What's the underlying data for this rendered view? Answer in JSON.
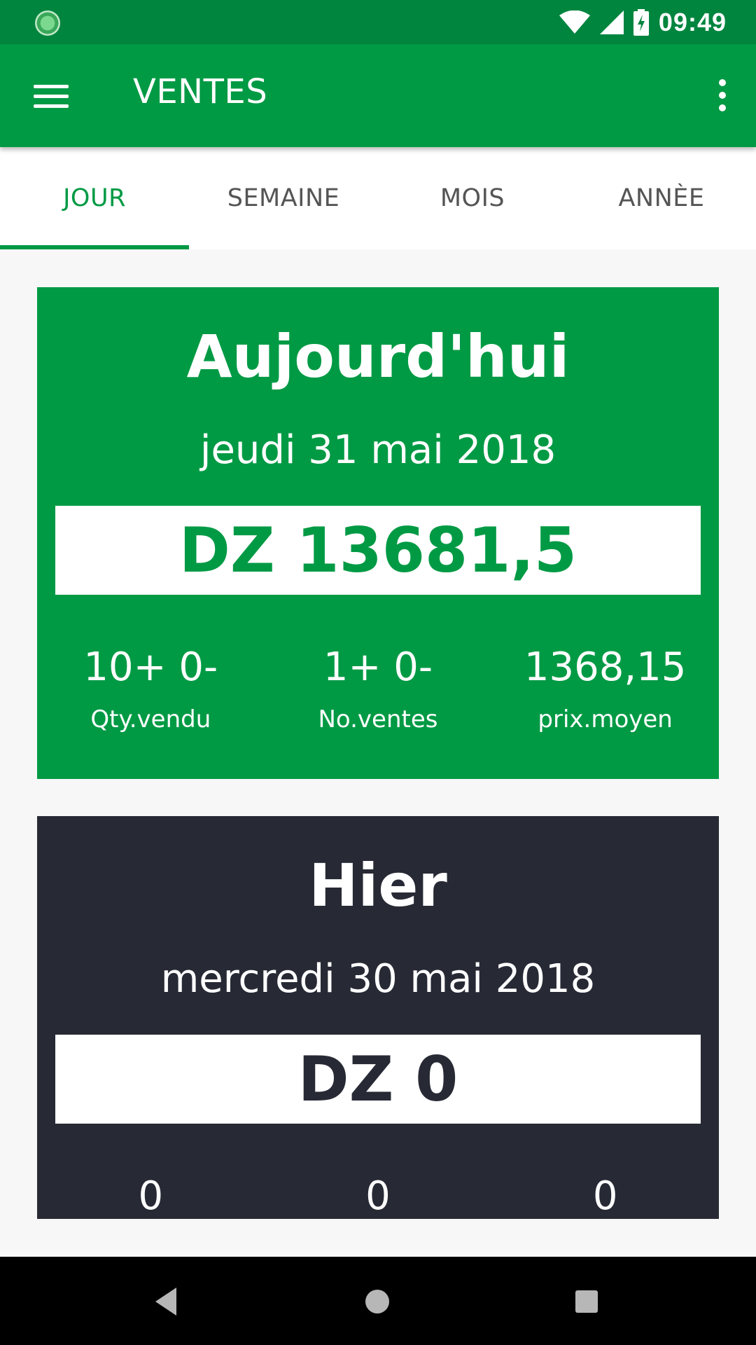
{
  "status_bar": {
    "time": "09:49",
    "icons": [
      "app-status-icon",
      "wifi-icon",
      "signal-icon",
      "battery-charging-icon"
    ]
  },
  "app_bar": {
    "title": "VENTES",
    "menu_icon": "hamburger-menu-icon",
    "overflow_icon": "more-vertical-icon"
  },
  "tabs": [
    {
      "label": "JOUR",
      "active": true
    },
    {
      "label": "SEMAINE",
      "active": false
    },
    {
      "label": "MOIS",
      "active": false
    },
    {
      "label": "ANNÈE",
      "active": false
    }
  ],
  "today": {
    "heading": "Aujourd'hui",
    "date": "jeudi 31 mai 2018",
    "amount": "DZ 13681,5",
    "stats": [
      {
        "value": "10+ 0-",
        "label": "Qty.vendu"
      },
      {
        "value": "1+ 0-",
        "label": "No.ventes"
      },
      {
        "value": "1368,15",
        "label": "prix.moyen"
      }
    ]
  },
  "yesterday": {
    "heading": "Hier",
    "date": "mercredi 30 mai 2018",
    "amount": "DZ 0",
    "stats": [
      {
        "value": "0"
      },
      {
        "value": "0"
      },
      {
        "value": "0"
      }
    ]
  },
  "colors": {
    "status_bar": "#00853f",
    "primary": "#009a44",
    "dark_card": "#272a35",
    "background": "#f7f7f7"
  },
  "nav_bar": {
    "icons": [
      "back-icon",
      "home-icon",
      "recents-icon"
    ]
  }
}
